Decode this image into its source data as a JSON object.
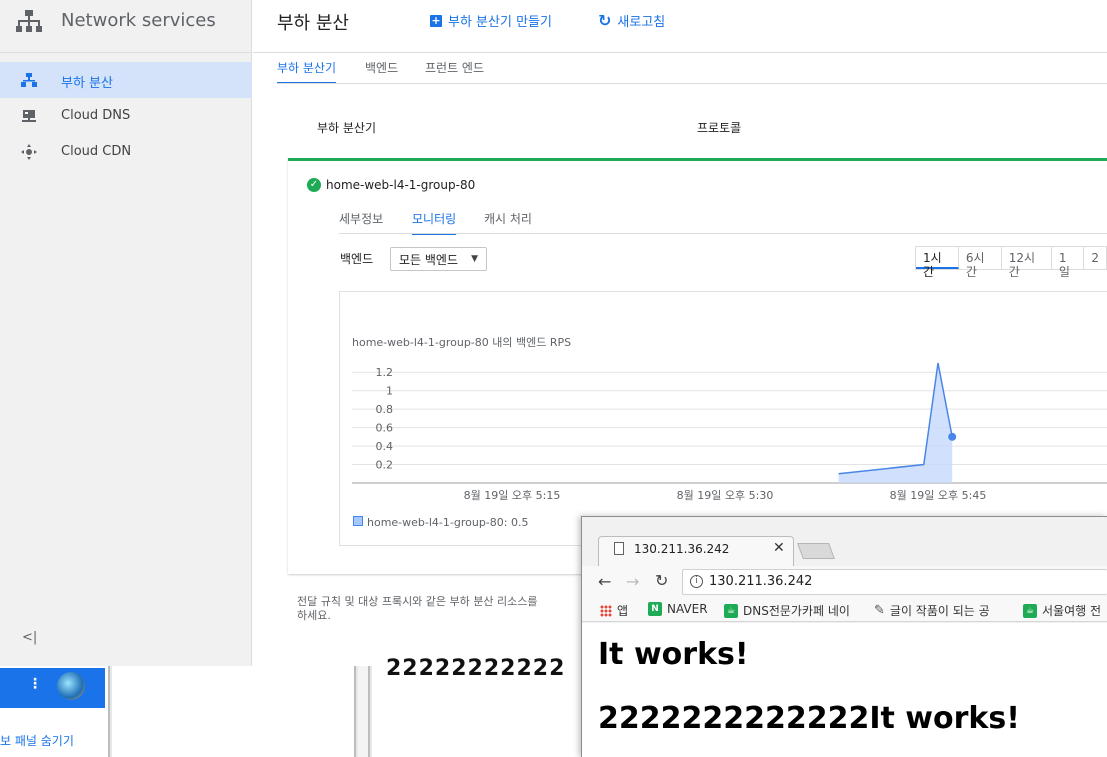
{
  "nav": {
    "title": "Network services",
    "items": [
      {
        "label": "부하 분산",
        "icon": "load-balancer-icon",
        "active": true
      },
      {
        "label": "Cloud DNS",
        "icon": "dns-icon",
        "active": false
      },
      {
        "label": "Cloud CDN",
        "icon": "cdn-icon",
        "active": false
      }
    ],
    "collapse_label": "<|"
  },
  "header": {
    "title": "부하 분산",
    "create_label": "부하 분산기 만들기",
    "refresh_label": "새로고침"
  },
  "tabs": [
    {
      "label": "부하 분산기",
      "active": true
    },
    {
      "label": "백엔드",
      "active": false
    },
    {
      "label": "프런트 엔드",
      "active": false
    }
  ],
  "table": {
    "col_load_balancer": "부하 분산기",
    "col_protocol": "프로토콜"
  },
  "card": {
    "name": "home-web-l4-1-group-80",
    "status": "healthy",
    "subtabs": [
      {
        "label": "세부정보",
        "active": false
      },
      {
        "label": "모니터링",
        "active": true
      },
      {
        "label": "캐시 처리",
        "active": false
      }
    ],
    "backend_label": "백엔드",
    "backend_select": "모든 백엔드",
    "time_ranges": [
      {
        "label": "1시간",
        "active": true
      },
      {
        "label": "6시간",
        "active": false
      },
      {
        "label": "12시간",
        "active": false
      },
      {
        "label": "1일",
        "active": false
      },
      {
        "label": "2",
        "active": false
      }
    ]
  },
  "chart_data": {
    "type": "area",
    "title": "home-web-l4-1-group-80 내의 백엔드 RPS",
    "xlabel": "",
    "ylabel": "",
    "y_ticks": [
      "1.2",
      "1",
      "0.8",
      "0.6",
      "0.4",
      "0.2"
    ],
    "ylim": [
      0,
      1.3
    ],
    "x_ticks": [
      "8월 19일 오후 5:15",
      "8월 19일 오후 5:30",
      "8월 19일 오후 5:45"
    ],
    "series": [
      {
        "name": "home-web-l4-1-group-80",
        "x": [
          "5:38",
          "5:44",
          "5:45",
          "5:46"
        ],
        "values": [
          0.1,
          0.2,
          1.3,
          0.5
        ]
      }
    ],
    "legend": "home-web-l4-1-group-80: 0.5",
    "color": "#4a86e8"
  },
  "footer_note": "전달 규칙 및 대상 프록시와 같은 부하 분산 리소스를 ... 하세요.",
  "footer_line1": "전달 규칙 및 대상 프록시와 같은 부하 분산 리소스를",
  "footer_line2": "하세요.",
  "background": {
    "hide_panel": "보 패널 숨기기",
    "digits": "22222222222"
  },
  "browser": {
    "tab_title": "130.211.36.242",
    "url": "130.211.36.242",
    "bookmarks": [
      {
        "label": "앱",
        "icon": "apps-icon"
      },
      {
        "label": "NAVER",
        "icon": "naver-icon"
      },
      {
        "label": "DNS전문가카페 네이",
        "icon": "cafe-icon"
      },
      {
        "label": "글이 작품이 되는 공",
        "icon": "pen-icon"
      },
      {
        "label": "서울여행 전",
        "icon": "cafe-icon"
      }
    ],
    "page_line1": "It works!",
    "page_line2": "2222222222222It works!"
  }
}
